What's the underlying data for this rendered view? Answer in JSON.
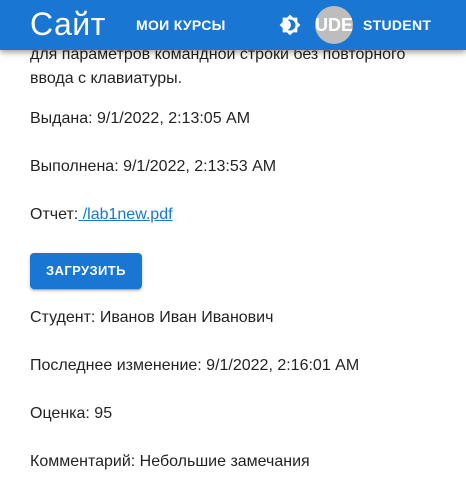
{
  "header": {
    "site_title": "Сайт",
    "nav_courses": "МОИ КУРСЫ",
    "theme_toggle_icon": "brightness-icon",
    "avatar_text": "UDE",
    "user_name": "STUDENT",
    "colors": {
      "appbar": "#1976d2",
      "avatar": "#bdbdbd"
    }
  },
  "assignment": {
    "description_partial_line1": "для параметров командной строки без повторного",
    "description_partial_line2": "ввода с клавиатуры.",
    "issued": "Выдана: 9/1/2022, 2:13:05 AM",
    "completed": "Выполнена: 9/1/2022, 2:13:53 AM",
    "report_label": "Отчет:",
    "report_link": " /lab1new.pdf",
    "upload_button": "ЗАГРУЗИТЬ",
    "student": "Студент: Иванов Иван Иванович",
    "last_modified": "Последнее изменение: 9/1/2022, 2:16:01 AM",
    "grade": "Оценка: 95",
    "comment": "Комментарий: Небольшие замечания",
    "colors": {
      "link": "#1976d2",
      "button": "#1976d2"
    }
  }
}
